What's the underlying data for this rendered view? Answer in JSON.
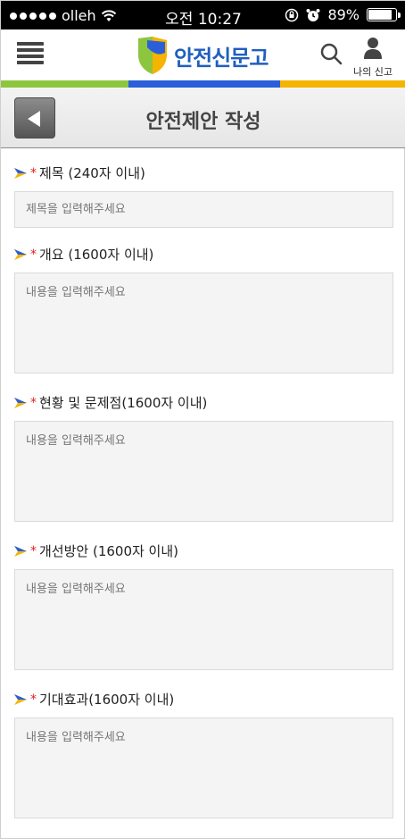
{
  "status": {
    "carrier": "olleh",
    "time": "오전 10:27",
    "battery": "89%",
    "battery_level": 0.89
  },
  "header": {
    "logo_text": "안전신문고",
    "my_report_label": "나의 신고"
  },
  "strip_colors": [
    "#8cc63f",
    "#2b5fd9",
    "#f5b400"
  ],
  "page": {
    "title": "안전제안 작성"
  },
  "form": {
    "required_mark": "*",
    "fields": [
      {
        "label": "제목 (240자 이내)",
        "placeholder": "제목을 입력해주세요"
      },
      {
        "label": "개요 (1600자 이내)",
        "placeholder": "내용을 입력해주세요"
      },
      {
        "label": "현황 및 문제점(1600자 이내)",
        "placeholder": "내용을 입력해주세요"
      },
      {
        "label": "개선방안 (1600자 이내)",
        "placeholder": "내용을 입력해주세요"
      },
      {
        "label": "기대효과(1600자 이내)",
        "placeholder": "내용을 입력해주세요"
      }
    ]
  }
}
